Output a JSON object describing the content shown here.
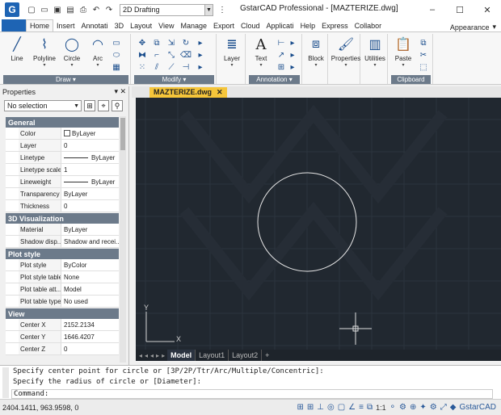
{
  "window": {
    "title": "GstarCAD Professional - [MAZTERIZE.dwg]",
    "logo_letter": "G",
    "workspace": "2D Drafting",
    "controls": {
      "minimize": "–",
      "maximize": "☐",
      "close": "✕"
    }
  },
  "ribbon_tabs": [
    "Home",
    "Insert",
    "Annotati",
    "3D",
    "Layout",
    "View",
    "Manage",
    "Export",
    "Cloud",
    "Applicati",
    "Help",
    "Express",
    "Collabor"
  ],
  "ribbon_right": {
    "appearance": "Appearance",
    "collapse": "▾"
  },
  "ribbon": {
    "draw": {
      "label": "Draw",
      "tools": [
        "Line",
        "Polyline",
        "Circle",
        "Arc"
      ]
    },
    "modify": {
      "label": "Modify"
    },
    "layer": "Layer",
    "annotation": {
      "label": "Annotation",
      "text": "Text",
      "text_icon": "A"
    },
    "block": "Block",
    "properties": "Properties",
    "utilities": "Utilities",
    "clipboard": {
      "label": "Clipboard",
      "paste": "Paste"
    }
  },
  "properties_panel": {
    "title": "Properties",
    "pin": "▾ ✕",
    "selection": "No selection",
    "sections": [
      {
        "title": "General",
        "rows": [
          {
            "key": "Color",
            "value": "ByLayer",
            "swatch": true
          },
          {
            "key": "Layer",
            "value": "0"
          },
          {
            "key": "Linetype",
            "value": "ByLayer",
            "line": true
          },
          {
            "key": "Linetype scale",
            "value": "1"
          },
          {
            "key": "Lineweight",
            "value": "ByLayer",
            "line": true
          },
          {
            "key": "Transparency",
            "value": "ByLayer"
          },
          {
            "key": "Thickness",
            "value": "0"
          }
        ]
      },
      {
        "title": "3D Visualization",
        "rows": [
          {
            "key": "Material",
            "value": "ByLayer"
          },
          {
            "key": "Shadow disp...",
            "value": "Shadow and recei..."
          }
        ]
      },
      {
        "title": "Plot style",
        "rows": [
          {
            "key": "Plot style",
            "value": "ByColor"
          },
          {
            "key": "Plot style table",
            "value": "None"
          },
          {
            "key": "Plot table att...",
            "value": "Model"
          },
          {
            "key": "Plot table type",
            "value": "No used"
          }
        ]
      },
      {
        "title": "View",
        "rows": [
          {
            "key": "Center X",
            "value": "2152.2134"
          },
          {
            "key": "Center Y",
            "value": "1646.4207"
          },
          {
            "key": "Center Z",
            "value": "0"
          }
        ]
      }
    ]
  },
  "document_tab": {
    "name": "MAZTERIZE.dwg",
    "close": "✕"
  },
  "layout_tabs": {
    "nav": "◂◂◂▸▸",
    "tabs": [
      "Model",
      "Layout1",
      "Layout2"
    ],
    "add": "+"
  },
  "ucs": {
    "x": "X",
    "y": "Y"
  },
  "command": {
    "history": [
      "Specify center point for circle or [3P/2P/Ttr/Arc/Multiple/Concentric]:",
      "Specify the radius of circle or [Diameter]:"
    ],
    "prompt": "Command:"
  },
  "status": {
    "coords": "2404.1411, 963.9598, 0",
    "scale": "1:1",
    "brand": "GstarCAD"
  },
  "colors": {
    "canvas": "#212830",
    "ribbon_label": "#6c7a8a",
    "doc_tab": "#f5c53a",
    "accent": "#1e64b4"
  }
}
